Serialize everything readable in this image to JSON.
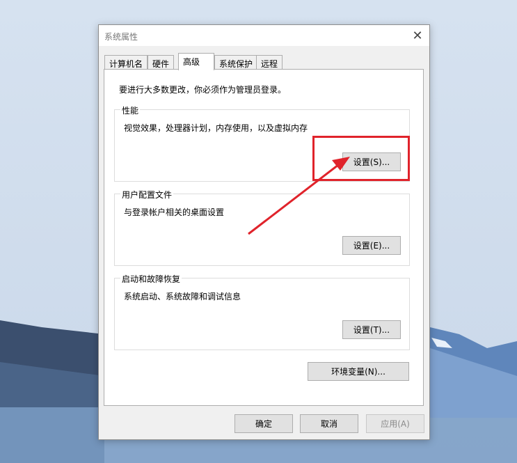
{
  "window": {
    "title": "系统属性",
    "close_glyph": "✕"
  },
  "tabs": [
    {
      "label": "计算机名",
      "active": false
    },
    {
      "label": "硬件",
      "active": false
    },
    {
      "label": "高级",
      "active": true
    },
    {
      "label": "系统保护",
      "active": false
    },
    {
      "label": "远程",
      "active": false
    }
  ],
  "admin_note": "要进行大多数更改，你必须作为管理员登录。",
  "groups": {
    "performance": {
      "title": "性能",
      "description": "视觉效果，处理器计划，内存使用，以及虚拟内存",
      "button": "设置(S)..."
    },
    "user_profiles": {
      "title": "用户配置文件",
      "description": "与登录帐户相关的桌面设置",
      "button": "设置(E)..."
    },
    "startup_recovery": {
      "title": "启动和故障恢复",
      "description": "系统启动、系统故障和调试信息",
      "button": "设置(T)..."
    }
  },
  "env_button": "环境变量(N)...",
  "footer": {
    "ok": "确定",
    "cancel": "取消",
    "apply": "应用(A)"
  },
  "annotation": {
    "color": "#e0232b"
  }
}
